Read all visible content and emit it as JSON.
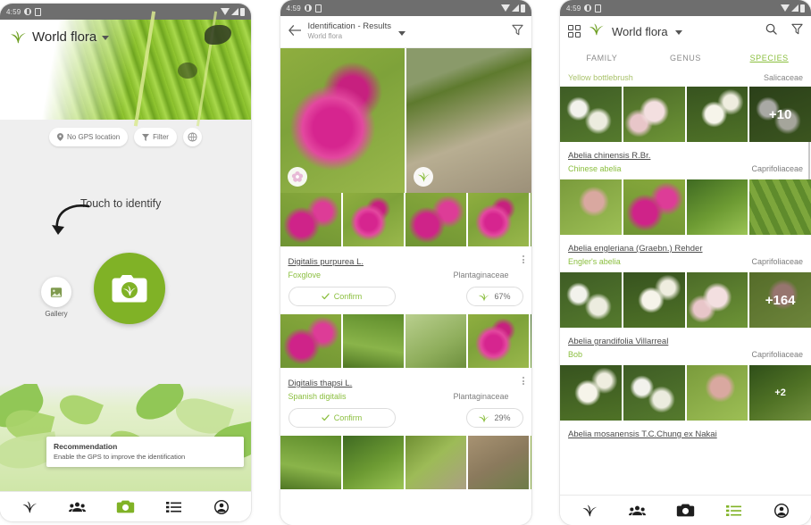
{
  "status_bar": {
    "time": "4:59"
  },
  "screen1": {
    "app_title": "World flora",
    "chips": [
      {
        "label": "No GPS location",
        "icon": "location-pin-icon"
      },
      {
        "label": "Filter",
        "icon": "filter-icon"
      },
      {
        "label": "",
        "icon": "globe-icon"
      }
    ],
    "touch_hint": "Touch to identify",
    "gallery_label": "Gallery",
    "snackbar": {
      "title": "Recommendation",
      "message": "Enable the GPS to improve the identification"
    },
    "nav": [
      {
        "name": "plant-icon",
        "active": false
      },
      {
        "name": "community-icon",
        "active": false
      },
      {
        "name": "camera-icon",
        "active": true
      },
      {
        "name": "list-icon",
        "active": false
      },
      {
        "name": "account-icon",
        "active": false
      }
    ]
  },
  "screen2": {
    "appbar": {
      "back_icon": "back-arrow-icon",
      "title": "Identification - Results",
      "subtitle": "World flora",
      "filter_icon": "filter-icon"
    },
    "results": [
      {
        "scientific_name": "Digitalis purpurea L.",
        "common_name": "Foxglove",
        "family": "Plantaginaceae",
        "confirm_label": "Confirm",
        "score": "67%"
      },
      {
        "scientific_name": "Digitalis thapsi L.",
        "common_name": "Spanish digitalis",
        "family": "Plantaginaceae",
        "confirm_label": "Confirm",
        "score": "29%"
      }
    ]
  },
  "screen3": {
    "appbar": {
      "grid_icon": "grid-view-icon",
      "title": "World flora",
      "search_icon": "search-icon",
      "filter_icon": "filter-icon"
    },
    "tabs": [
      {
        "label": "FAMILY",
        "active": false
      },
      {
        "label": "GENUS",
        "active": false
      },
      {
        "label": "SPECIES",
        "active": true
      }
    ],
    "subheader": {
      "left": "Yellow bottlebrush",
      "right": "Salicaceae"
    },
    "species": [
      {
        "scientific_name": "Abelia chinensis R.Br.",
        "common_name": "Chinese abelia",
        "family": "Caprifoliaceae",
        "more_count": "+10"
      },
      {
        "scientific_name": "Abelia engleriana (Graebn.) Rehder",
        "common_name": "Engler's abelia",
        "family": "Caprifoliaceae",
        "more_count": "+164"
      },
      {
        "scientific_name": "Abelia grandifolia Villarreal",
        "common_name": "Bob",
        "family": "Caprifoliaceae",
        "more_count": "+2"
      },
      {
        "scientific_name": "Abelia mosanensis T.C.Chung ex Nakai",
        "common_name": "",
        "family": "",
        "more_count": ""
      }
    ],
    "nav": [
      {
        "name": "plant-icon",
        "active": false
      },
      {
        "name": "community-icon",
        "active": false
      },
      {
        "name": "camera-icon",
        "active": false
      },
      {
        "name": "list-icon",
        "active": true
      },
      {
        "name": "account-icon",
        "active": false
      }
    ]
  },
  "colors": {
    "accent_green": "#80b226",
    "light_green": "#8bbf3f",
    "status_bar": "#6e6e6e"
  }
}
